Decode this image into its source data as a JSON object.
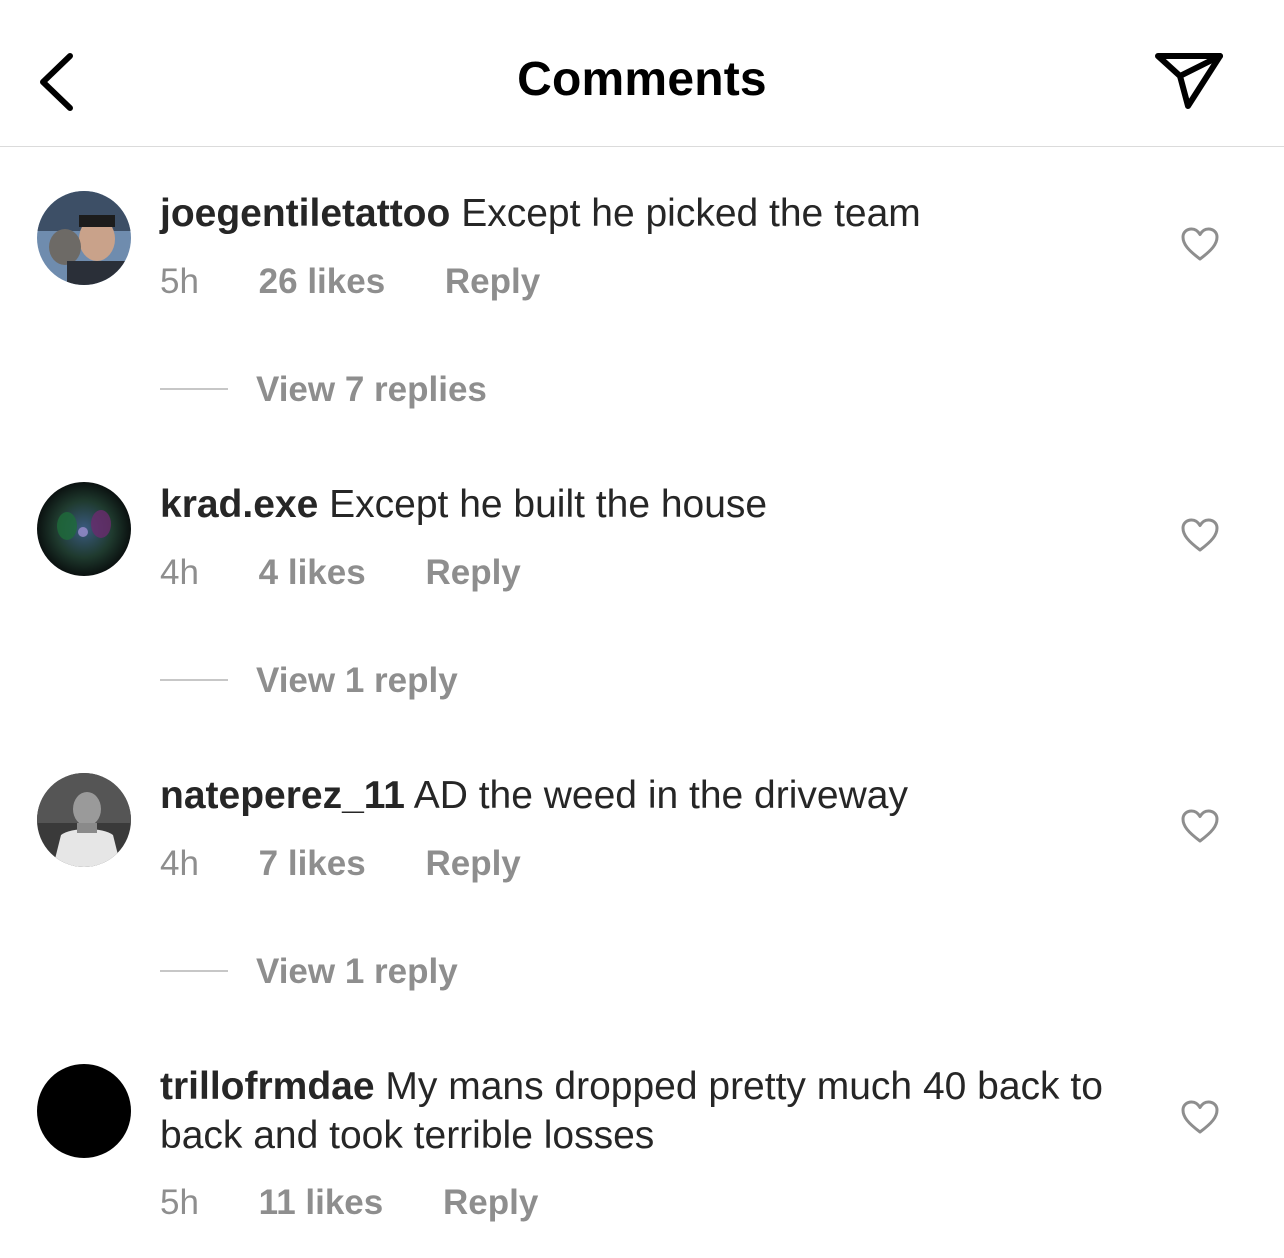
{
  "header": {
    "title": "Comments"
  },
  "comments": [
    {
      "username": "joegentiletattoo",
      "text": "Except he picked the team",
      "time": "5h",
      "likes": "26 likes",
      "reply": "Reply",
      "view_replies": "View 7 replies"
    },
    {
      "username": "krad.exe",
      "text": "Except he built the house",
      "time": "4h",
      "likes": "4 likes",
      "reply": "Reply",
      "view_replies": "View 1 reply"
    },
    {
      "username": "nateperez_11",
      "text": "AD the weed in the driveway",
      "time": "4h",
      "likes": "7 likes",
      "reply": "Reply",
      "view_replies": "View 1 reply"
    },
    {
      "username": "trillofrmdae",
      "text": "My mans dropped pretty much 40 back to back and took terrible losses",
      "time": "5h",
      "likes": "11 likes",
      "reply": "Reply"
    }
  ],
  "icons": {
    "back": "chevron-left-icon",
    "send": "paper-plane-icon",
    "like": "heart-outline-icon"
  }
}
